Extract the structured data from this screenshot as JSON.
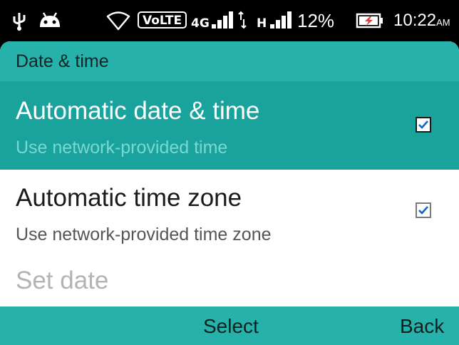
{
  "status_bar": {
    "icons": [
      "usb-icon",
      "android-icon",
      "wifi-icon",
      "signal-icon",
      "data-arrows-icon",
      "battery-charging-icon"
    ],
    "volte": "VoLTE",
    "network_4g": "4G",
    "network_h": "H",
    "battery_percent": "12%",
    "time": "10:22",
    "ampm": "AM"
  },
  "title_bar": {
    "title": "Date & time"
  },
  "preferences": [
    {
      "title": "Automatic date & time",
      "summary": "Use network-provided time",
      "checked": true,
      "selected": true
    },
    {
      "title": "Automatic time zone",
      "summary": "Use network-provided time zone",
      "checked": true,
      "selected": false
    },
    {
      "title": "Set date",
      "enabled": false
    }
  ],
  "softkeys": {
    "center": "Select",
    "right": "Back"
  },
  "colors": {
    "accent": "#26b1aa",
    "selected_row": "#1aa29d",
    "check_blue": "#1565c0"
  }
}
